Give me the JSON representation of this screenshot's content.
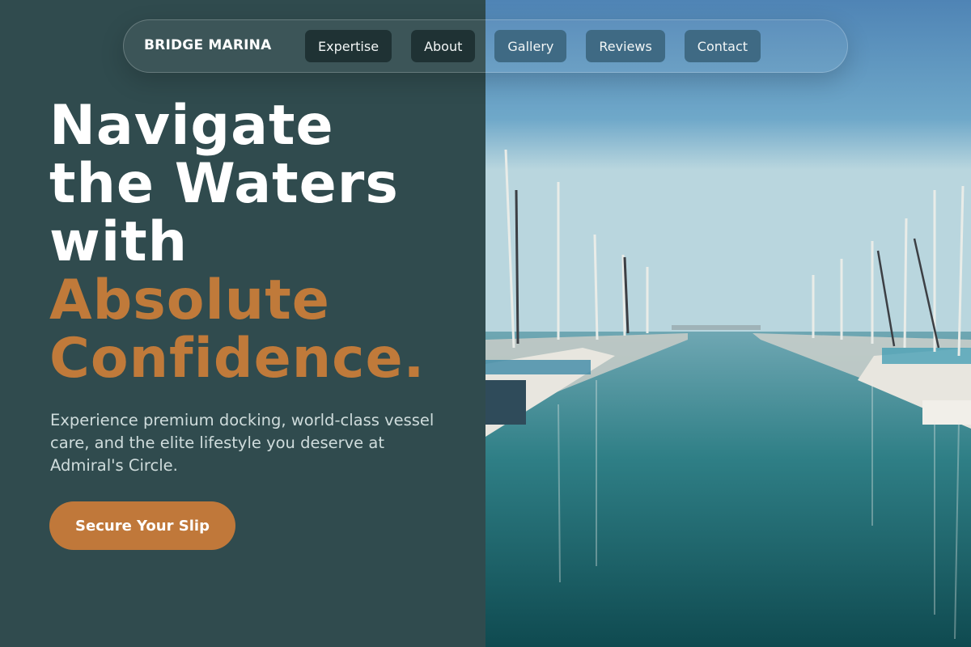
{
  "nav": {
    "brand": "BRIDGE MARINA",
    "links": [
      {
        "label": "Expertise"
      },
      {
        "label": "About"
      },
      {
        "label": "Gallery"
      },
      {
        "label": "Reviews"
      },
      {
        "label": "Contact"
      }
    ]
  },
  "hero": {
    "title_lines": [
      "Navigate",
      "the Waters",
      "with"
    ],
    "accent_lines": [
      "Absolute",
      "Confidence."
    ],
    "subtitle": "Experience premium docking, world-class vessel care, and the elite lifestyle you deserve at Admiral's Circle.",
    "cta_label": "Secure Your Slip"
  },
  "colors": {
    "panel": "#304b4e",
    "accent": "#c07a3a",
    "nav_dark": "#1f3234",
    "nav_light": "#3f6a84"
  }
}
